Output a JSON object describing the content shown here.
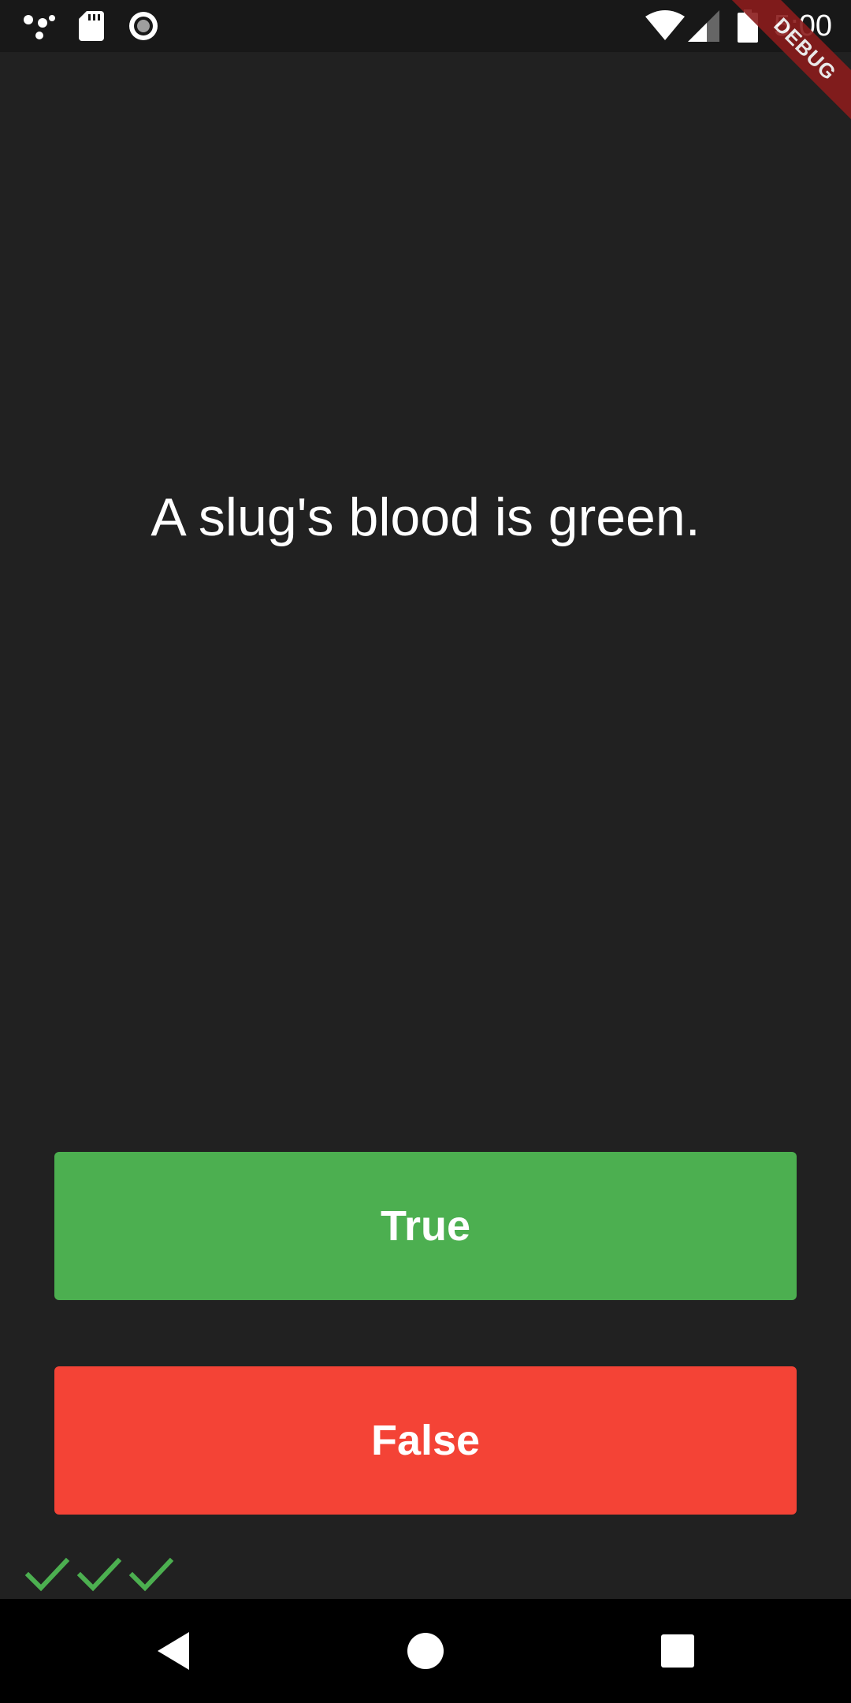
{
  "status_bar": {
    "time": "5:00",
    "icons": [
      "assistant-dots-icon",
      "sd-card-icon",
      "record-icon",
      "wifi-icon",
      "cell-signal-icon",
      "battery-icon"
    ]
  },
  "debug_banner": {
    "label": "DEBUG",
    "color": "#8b1c1c"
  },
  "quiz": {
    "question": "A slug's blood is green.",
    "true_label": "True",
    "false_label": "False",
    "true_color": "#4caf50",
    "false_color": "#f44336"
  },
  "score": {
    "marks": [
      "check",
      "check",
      "check"
    ],
    "check_color": "#4caf50"
  },
  "nav_bar": {
    "buttons": [
      "back-icon",
      "home-icon",
      "recents-icon"
    ]
  },
  "colors": {
    "background": "#212121",
    "status_bar": "#181818",
    "nav_bar": "#000000"
  }
}
